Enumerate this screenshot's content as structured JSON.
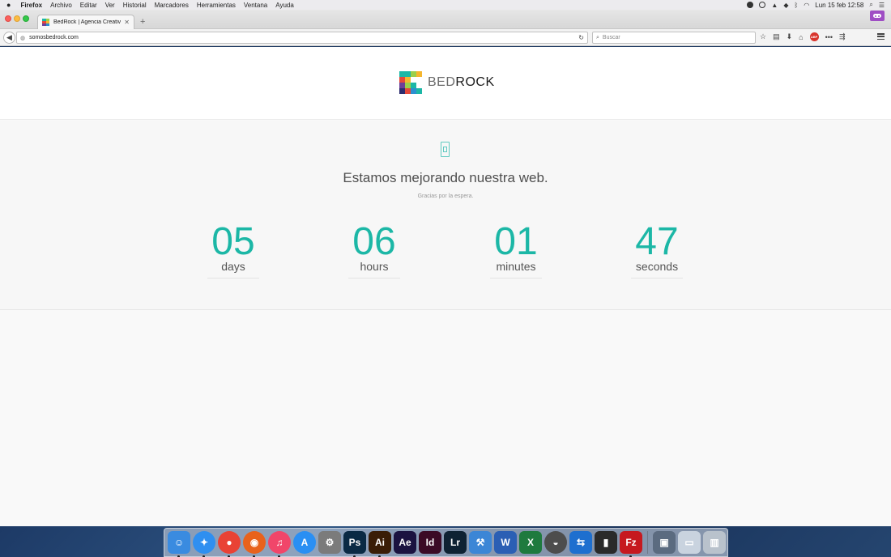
{
  "menubar": {
    "app_name": "Firefox",
    "menus": [
      "Archivo",
      "Editar",
      "Ver",
      "Historial",
      "Marcadores",
      "Herramientas",
      "Ventana",
      "Ayuda"
    ],
    "clock": "Lun 15 feb  12:58"
  },
  "browser": {
    "tab_title": "BedRock | Agencia Creativ...",
    "url": "somosbedrock.com",
    "search_placeholder": "Buscar"
  },
  "site": {
    "logo_light": "BED",
    "logo_strong": "ROCK",
    "headline": "Estamos mejorando nuestra web.",
    "subline": "Gracias por la espera.",
    "countdown": [
      {
        "value": "05",
        "label": "days"
      },
      {
        "value": "06",
        "label": "hours"
      },
      {
        "value": "01",
        "label": "minutes"
      },
      {
        "value": "47",
        "label": "seconds"
      }
    ],
    "accent_color": "#1cb7a6"
  },
  "dock": {
    "icons": [
      {
        "name": "finder-icon",
        "glyph": "☺",
        "color": "#3a8be0",
        "running": true
      },
      {
        "name": "safari-icon",
        "glyph": "✦",
        "color": "#2f8ff0",
        "running": true,
        "round": true
      },
      {
        "name": "chrome-icon",
        "glyph": "●",
        "color": "#e94235",
        "running": true,
        "round": true
      },
      {
        "name": "firefox-icon",
        "glyph": "◉",
        "color": "#e8621c",
        "running": true,
        "round": true
      },
      {
        "name": "itunes-icon",
        "glyph": "♫",
        "color": "#f1466a",
        "running": true,
        "round": true
      },
      {
        "name": "app-store-icon",
        "glyph": "A",
        "color": "#2a8ff3",
        "running": false,
        "round": true
      },
      {
        "name": "system-preferences-icon",
        "glyph": "⚙",
        "color": "#7b7b7b",
        "running": false
      },
      {
        "name": "photoshop-icon",
        "glyph": "Ps",
        "color": "#0a2a44",
        "running": true
      },
      {
        "name": "illustrator-icon",
        "glyph": "Ai",
        "color": "#3a1d06",
        "running": true
      },
      {
        "name": "after-effects-icon",
        "glyph": "Ae",
        "color": "#1b1340",
        "running": false
      },
      {
        "name": "indesign-icon",
        "glyph": "Id",
        "color": "#3b0a25",
        "running": false
      },
      {
        "name": "lightroom-icon",
        "glyph": "Lr",
        "color": "#0e2233",
        "running": false
      },
      {
        "name": "xcode-icon",
        "glyph": "⚒",
        "color": "#3c86d6",
        "running": false
      },
      {
        "name": "word-icon",
        "glyph": "W",
        "color": "#2b5fb4",
        "running": false
      },
      {
        "name": "excel-icon",
        "glyph": "X",
        "color": "#1e7a3e",
        "running": false
      },
      {
        "name": "elephant-icon",
        "glyph": "◒",
        "color": "#4d4d4d",
        "running": false,
        "round": true
      },
      {
        "name": "teamviewer-icon",
        "glyph": "⇆",
        "color": "#1e6fcf",
        "running": false
      },
      {
        "name": "battery-app-icon",
        "glyph": "▮",
        "color": "#2a2a2a",
        "running": false
      },
      {
        "name": "filezilla-icon",
        "glyph": "Fz",
        "color": "#c6191f",
        "running": true
      },
      {
        "name": "photo-thumbnail-icon",
        "glyph": "▣",
        "color": "#5b6b80",
        "running": false
      },
      {
        "name": "preview-window-icon",
        "glyph": "▭",
        "color": "#c9d3df",
        "running": false
      },
      {
        "name": "trash-icon",
        "glyph": "▥",
        "color": "#b9c2cc",
        "running": false
      }
    ]
  }
}
